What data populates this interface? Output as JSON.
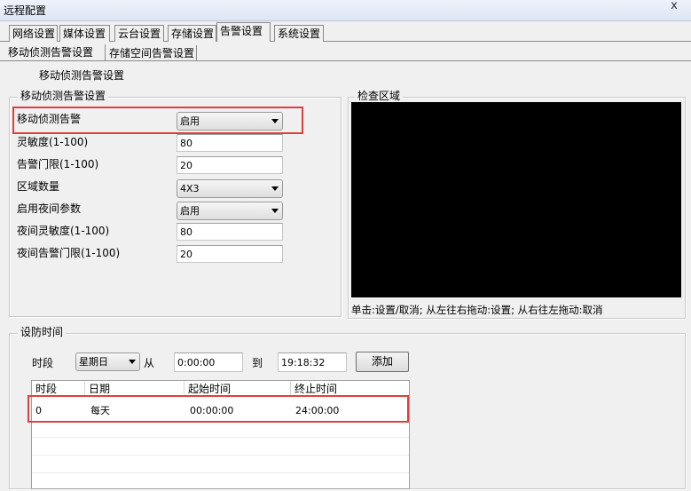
{
  "window": {
    "title": "远程配置",
    "close_label": "x"
  },
  "tabs": [
    "网络设置",
    "媒体设置",
    "云台设置",
    "存储设置",
    "告警设置",
    "系统设置"
  ],
  "subtabs": [
    "移动侦测告警设置",
    "存储空间告警设置"
  ],
  "page_title": "移动侦测告警设置",
  "motion_group": {
    "title": "移动侦测告警设置",
    "fields": [
      {
        "label": "移动侦测告警",
        "value": "启用"
      },
      {
        "label": "灵敏度(1-100)",
        "value": "80"
      },
      {
        "label": "告警门限(1-100)",
        "value": "20"
      },
      {
        "label": "区域数量",
        "value": "4X3"
      },
      {
        "label": "启用夜间参数",
        "value": "启用"
      },
      {
        "label": "夜间灵敏度(1-100)",
        "value": "80"
      },
      {
        "label": "夜间告警门限(1-100)",
        "value": "20"
      }
    ]
  },
  "check_area": {
    "title": "检查区域",
    "hint": "单击:设置/取消; 从左往右拖动:设置; 从右往左拖动:取消"
  },
  "schedule": {
    "title": "设防时间",
    "period_label": "时段",
    "weekday": "星期日",
    "from_label": "从",
    "from_time": "0:00:00",
    "to_label": "到",
    "to_time": "19:18:32",
    "add_label": "添加",
    "columns": [
      "时段",
      "日期",
      "起始时间",
      "终止时间"
    ],
    "rows": [
      {
        "slot": "0",
        "date": "每天",
        "start": "00:00:00",
        "end": "24:00:00"
      }
    ]
  },
  "colors": {
    "highlight": "#e0403c",
    "preview": "#000000"
  }
}
